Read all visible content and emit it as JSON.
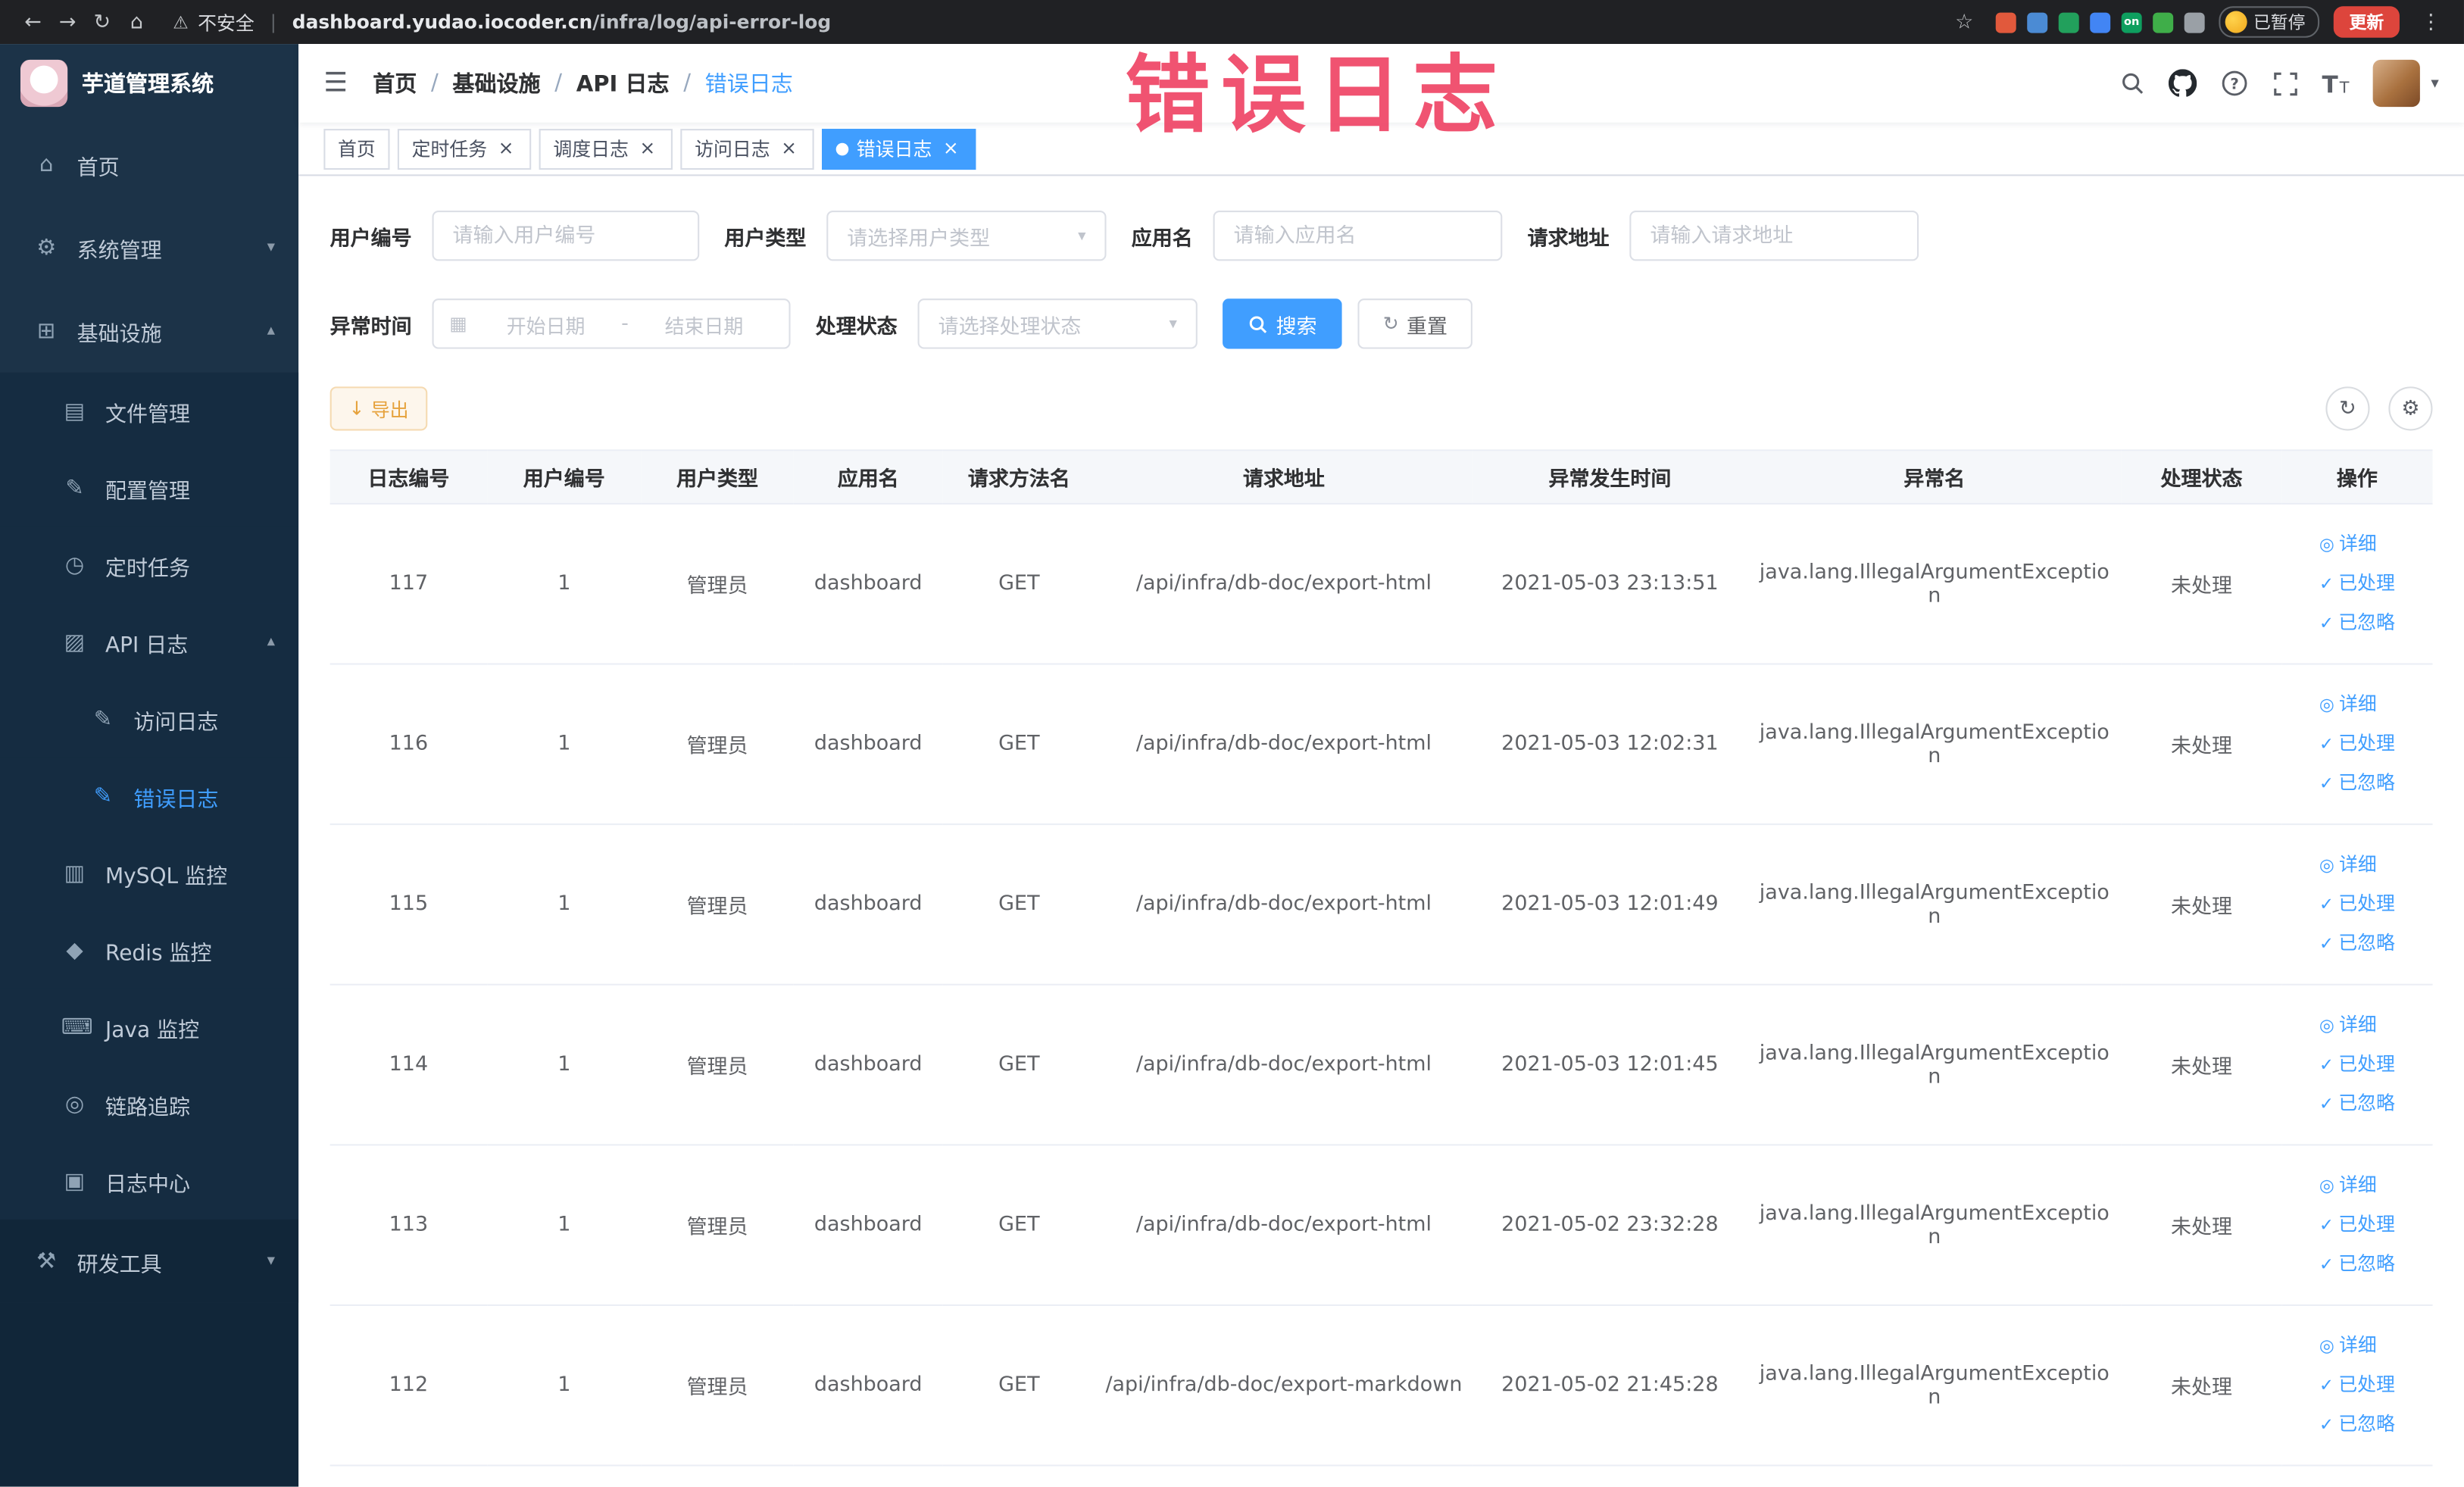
{
  "browser": {
    "back_icon": "←",
    "forward_icon": "→",
    "reload_icon": "↻",
    "home_icon": "⌂",
    "warning_icon": "⚠",
    "security_label": "不安全",
    "address_divider": "|",
    "url_host": "dashboard.yudao.iocoder.cn",
    "url_path": "/infra/log/api-error-log",
    "star_icon": "☆",
    "extensions": [
      {
        "name": "extension-orange",
        "color": "#e1593c",
        "label": ""
      },
      {
        "name": "extension-blue",
        "color": "#4b8bd4",
        "label": ""
      },
      {
        "name": "extension-green-circle",
        "color": "#22a05c",
        "label": ""
      },
      {
        "name": "extension-grid",
        "color": "#4285f4",
        "label": ""
      },
      {
        "name": "extension-on-badge",
        "color": "#0e9f5f",
        "label": "on"
      },
      {
        "name": "extension-leaf",
        "color": "#3fae49",
        "label": ""
      },
      {
        "name": "extension-puzzle",
        "color": "#9aa0a6",
        "label": ""
      }
    ],
    "paused_badge": "已暂停",
    "update_label": "更新",
    "kebab_icon": "⋮"
  },
  "overlay_text": "错误日志",
  "icons": {
    "hamburger": "☰",
    "avatar_caret": "▾",
    "calendar": "▦",
    "select_chevron": "▾",
    "export_arrow": "↓",
    "refresh": "↻",
    "settings": "⚙",
    "reset": "↻"
  },
  "sidebar": {
    "logo_title": "芋道管理系统",
    "items": [
      {
        "id": "home",
        "label": "首页",
        "glyph": "⌂",
        "icon": "home-icon",
        "level": 0
      },
      {
        "id": "system-mgmt",
        "label": "系统管理",
        "glyph": "⚙",
        "icon": "gear-icon",
        "level": 0,
        "arrow": "down"
      },
      {
        "id": "infrastructure",
        "label": "基础设施",
        "glyph": "⊞",
        "icon": "infrastructure-icon",
        "level": 0,
        "arrow": "up"
      },
      {
        "id": "file-mgmt",
        "label": "文件管理",
        "glyph": "▤",
        "icon": "file-icon",
        "level": 1,
        "sub": true
      },
      {
        "id": "config-mgmt",
        "label": "配置管理",
        "glyph": "✎",
        "icon": "config-icon",
        "level": 1,
        "sub": true
      },
      {
        "id": "scheduled-tasks",
        "label": "定时任务",
        "glyph": "◷",
        "icon": "timer-icon",
        "level": 1,
        "sub": true
      },
      {
        "id": "api-log",
        "label": "API 日志",
        "glyph": "▨",
        "icon": "api-log-icon",
        "level": 1,
        "sub": true,
        "arrow": "up"
      },
      {
        "id": "access-log",
        "label": "访问日志",
        "glyph": "✎",
        "icon": "access-log-icon",
        "level": 2,
        "sub": true
      },
      {
        "id": "error-log",
        "label": "错误日志",
        "glyph": "✎",
        "icon": "error-log-icon",
        "level": 2,
        "sub": true,
        "active": true
      },
      {
        "id": "mysql-monitor",
        "label": "MySQL 监控",
        "glyph": "▥",
        "icon": "mysql-icon",
        "level": 1,
        "sub": true
      },
      {
        "id": "redis-monitor",
        "label": "Redis 监控",
        "glyph": "◆",
        "icon": "redis-icon",
        "level": 1,
        "sub": true
      },
      {
        "id": "java-monitor",
        "label": "Java 监控",
        "glyph": "⌨",
        "icon": "java-icon",
        "level": 1,
        "sub": true
      },
      {
        "id": "link-trace",
        "label": "链路追踪",
        "glyph": "◎",
        "icon": "trace-icon",
        "level": 1,
        "sub": true
      },
      {
        "id": "log-center",
        "label": "日志中心",
        "glyph": "▣",
        "icon": "log-center-icon",
        "level": 1,
        "sub": true
      },
      {
        "id": "dev-tools",
        "label": "研发工具",
        "glyph": "⚒",
        "icon": "devtools-icon",
        "level": 0,
        "arrow": "down",
        "dark": true
      }
    ]
  },
  "header": {
    "separator": "/",
    "breadcrumb": [
      {
        "label": "首页"
      },
      {
        "label": "基础设施"
      },
      {
        "label": "API 日志"
      },
      {
        "label": "错误日志",
        "active": true
      }
    ]
  },
  "tabs": [
    {
      "key": "home",
      "label": "首页",
      "closable": false,
      "active": false
    },
    {
      "key": "scheduled-tasks",
      "label": "定时任务",
      "closable": true,
      "active": false
    },
    {
      "key": "schedule-log",
      "label": "调度日志",
      "closable": true,
      "active": false
    },
    {
      "key": "access-log",
      "label": "访问日志",
      "closable": true,
      "active": false
    },
    {
      "key": "error-log",
      "label": "错误日志",
      "closable": true,
      "active": true
    }
  ],
  "filters": {
    "user_id_label": "用户编号",
    "user_id_placeholder": "请输入用户编号",
    "user_type_label": "用户类型",
    "user_type_placeholder": "请选择用户类型",
    "app_name_label": "应用名",
    "app_name_placeholder": "请输入应用名",
    "request_url_label": "请求地址",
    "request_url_placeholder": "请输入请求地址",
    "exception_time_label": "异常时间",
    "date_start_placeholder": "开始日期",
    "date_separator": "-",
    "date_end_placeholder": "结束日期",
    "process_status_label": "处理状态",
    "process_status_placeholder": "请选择处理状态",
    "search_label": "搜索",
    "reset_label": "重置"
  },
  "toolbar": {
    "export_label": "导出"
  },
  "table": {
    "columns": [
      "日志编号",
      "用户编号",
      "用户类型",
      "应用名",
      "请求方法名",
      "请求地址",
      "异常发生时间",
      "异常名",
      "处理状态",
      "操作"
    ],
    "column_keys": [
      "log-id",
      "user-id",
      "user-type",
      "app-name",
      "method",
      "request-url",
      "exception-time",
      "exception-name",
      "status",
      "actions"
    ],
    "actions": [
      {
        "key": "detail",
        "label": "详细",
        "glyph": "◎",
        "icon": "view-icon"
      },
      {
        "key": "processed",
        "label": "已处理",
        "glyph": "✓",
        "icon": "check-icon"
      },
      {
        "key": "ignored",
        "label": "已忽略",
        "glyph": "✓",
        "icon": "check-icon"
      }
    ],
    "rows": [
      {
        "id": "117",
        "user_id": "1",
        "user_type": "管理员",
        "app": "dashboard",
        "method": "GET",
        "url": "/api/infra/db-doc/export-html",
        "time": "2021-05-03 23:13:51",
        "exception": "java.lang.IllegalArgumentException",
        "status": "未处理"
      },
      {
        "id": "116",
        "user_id": "1",
        "user_type": "管理员",
        "app": "dashboard",
        "method": "GET",
        "url": "/api/infra/db-doc/export-html",
        "time": "2021-05-03 12:02:31",
        "exception": "java.lang.IllegalArgumentException",
        "status": "未处理"
      },
      {
        "id": "115",
        "user_id": "1",
        "user_type": "管理员",
        "app": "dashboard",
        "method": "GET",
        "url": "/api/infra/db-doc/export-html",
        "time": "2021-05-03 12:01:49",
        "exception": "java.lang.IllegalArgumentException",
        "status": "未处理"
      },
      {
        "id": "114",
        "user_id": "1",
        "user_type": "管理员",
        "app": "dashboard",
        "method": "GET",
        "url": "/api/infra/db-doc/export-html",
        "time": "2021-05-03 12:01:45",
        "exception": "java.lang.IllegalArgumentException",
        "status": "未处理"
      },
      {
        "id": "113",
        "user_id": "1",
        "user_type": "管理员",
        "app": "dashboard",
        "method": "GET",
        "url": "/api/infra/db-doc/export-html",
        "time": "2021-05-02 23:32:28",
        "exception": "java.lang.IllegalArgumentException",
        "status": "未处理"
      },
      {
        "id": "112",
        "user_id": "1",
        "user_type": "管理员",
        "app": "dashboard",
        "method": "GET",
        "url": "/api/infra/db-doc/export-markdown",
        "time": "2021-05-02 21:45:28",
        "exception": "java.lang.IllegalArgumentException",
        "status": "未处理"
      }
    ]
  }
}
